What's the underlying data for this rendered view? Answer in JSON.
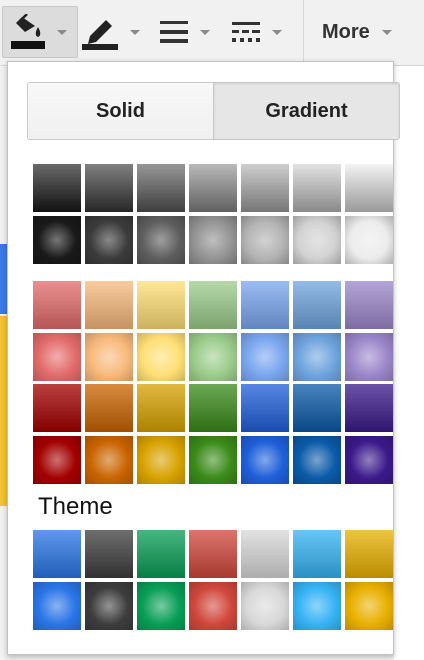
{
  "toolbar": {
    "tools": [
      {
        "name": "fill-color",
        "icon": "paint-bucket-icon",
        "active": true
      },
      {
        "name": "border-color",
        "icon": "pencil-icon"
      },
      {
        "name": "border-weight",
        "icon": "line-weight-icon"
      },
      {
        "name": "border-dash",
        "icon": "line-dash-icon"
      }
    ],
    "more_label": "More"
  },
  "popup": {
    "tabs": [
      {
        "label": "Solid",
        "selected": false
      },
      {
        "label": "Gradient",
        "selected": true
      }
    ],
    "theme_label": "Theme"
  },
  "palette": {
    "gray": [
      "#1a1a1a",
      "#3c3c3c",
      "#5f5f5f",
      "#949494",
      "#b4b4b4",
      "#d2d2d2",
      "#ececec"
    ],
    "colors": [
      "#e36b6b",
      "#f7b97c",
      "#ffdf76",
      "#9ccc8c",
      "#7aa6ef",
      "#6fa4dd",
      "#9b87c9"
    ],
    "deep": [
      "#a30000",
      "#c96400",
      "#d7a200",
      "#3b8a19",
      "#1f5fd9",
      "#0b5aa8",
      "#3b1a8a"
    ],
    "theme": [
      "#2a75e6",
      "#3d3d3d",
      "#099e56",
      "#d0473c",
      "#d8d8d8",
      "#36b3f4",
      "#e8b000"
    ]
  }
}
